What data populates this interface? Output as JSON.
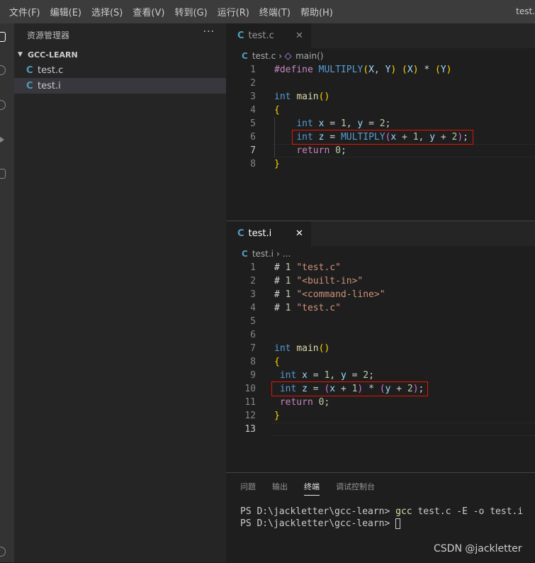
{
  "menu": [
    "文件(F)",
    "编辑(E)",
    "选择(S)",
    "查看(V)",
    "转到(G)",
    "运行(R)",
    "终端(T)",
    "帮助(H)"
  ],
  "window_title": "test.",
  "explorer": {
    "title": "资源管理器",
    "more": "···",
    "folder": "GCC-LEARN",
    "files": [
      "test.c",
      "test.i"
    ]
  },
  "icons": {
    "file": "c-file-icon",
    "close": "close-icon",
    "symbol": "method-symbol-icon"
  },
  "colors": {
    "highlight_box": "#e51400",
    "c_icon": "#519aba"
  },
  "editor_top": {
    "tab": "test.c",
    "close": "✕",
    "breadcrumb_file": "test.c",
    "breadcrumb_symbol": "main()",
    "line_numbers": [
      "1",
      "2",
      "3",
      "4",
      "5",
      "6",
      "7",
      "8"
    ],
    "lines": [
      "#define MULTIPLY(X, Y) (X) * (Y)",
      "",
      "int main()",
      "{",
      "    int x = 1, y = 2;",
      "    int z = MULTIPLY(x + 1, y + 2);",
      "    return 0;",
      "}"
    ]
  },
  "editor_bottom": {
    "tab": "test.i",
    "close": "✕",
    "breadcrumb_file": "test.i",
    "breadcrumb_more": "...",
    "line_numbers": [
      "1",
      "2",
      "3",
      "4",
      "5",
      "6",
      "7",
      "8",
      "9",
      "10",
      "11",
      "12",
      "13"
    ],
    "lines": [
      "# 1 \"test.c\"",
      "# 1 \"<built-in>\"",
      "# 1 \"<command-line>\"",
      "# 1 \"test.c\"",
      "",
      "",
      "int main()",
      "{",
      " int x = 1, y = 2;",
      " int z = (x + 1) * (y + 2);",
      " return 0;",
      "}",
      ""
    ]
  },
  "panel": {
    "tabs": [
      "问题",
      "输出",
      "终端",
      "调试控制台"
    ],
    "terminal": [
      {
        "prompt": "PS D:\\jackletter\\gcc-learn> ",
        "cmd": "gcc",
        "args": " test.c -E -o test.i"
      },
      {
        "prompt": "PS D:\\jackletter\\gcc-learn> ",
        "cmd": "",
        "args": ""
      }
    ]
  },
  "watermark": "CSDN @jackletter"
}
